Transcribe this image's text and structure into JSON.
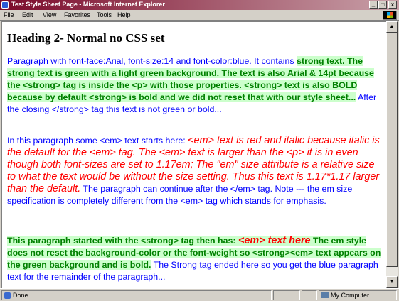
{
  "window": {
    "title": "Test Style Sheet Page - Microsoft Internet Explorer",
    "minimize": "_",
    "maximize": "□",
    "close": "x"
  },
  "menu": [
    "File",
    "Edit",
    "View",
    "Favorites",
    "Tools",
    "Help"
  ],
  "page": {
    "heading": "Heading 2- Normal no CSS set",
    "p1": {
      "t1": "Paragraph with font-face:Arial, font-size:14 and font-color:blue.  It contains ",
      "strong": "strong text.  The strong text is green with a light green background.  The text is also Arial & 14pt because the <strong> tag is inside the <p> with those properties.  <strong> text is also BOLD because by default <strong> is bold and we did not reset that with our style sheet...",
      "t2": " After the closing </strong> tag this text is not green or bold..."
    },
    "p2": {
      "t1": "In this paragraph some <em> text starts here: ",
      "em": "<em> text is red and italic because italic is the default for the <em> tag.  The <em> text is larger than the <p> it is in even though both font-sizes are set to 1.17em;  The \"em\" size attribute is a relative size to what the text would be without the size setting.  Thus this text is 1.17*1.17 larger than the default.",
      "t2": "  The paragraph can continue after the </em> tag. Note --- the em size specification is completely different from the <em> tag which stands for emphasis."
    },
    "p3": {
      "strong1": "This paragraph started with the <strong> tag then has: ",
      "em": "<em> text here",
      "strong2": " The em style does not reset the background-color or the font-weight so <strong><em> text appears on the green background and is bold.",
      "t1": "  The Strong tag ended here so  you get the blue paragraph text for the remainder of the paragraph..."
    }
  },
  "status": {
    "left": "Done",
    "zone": "My Computer"
  }
}
